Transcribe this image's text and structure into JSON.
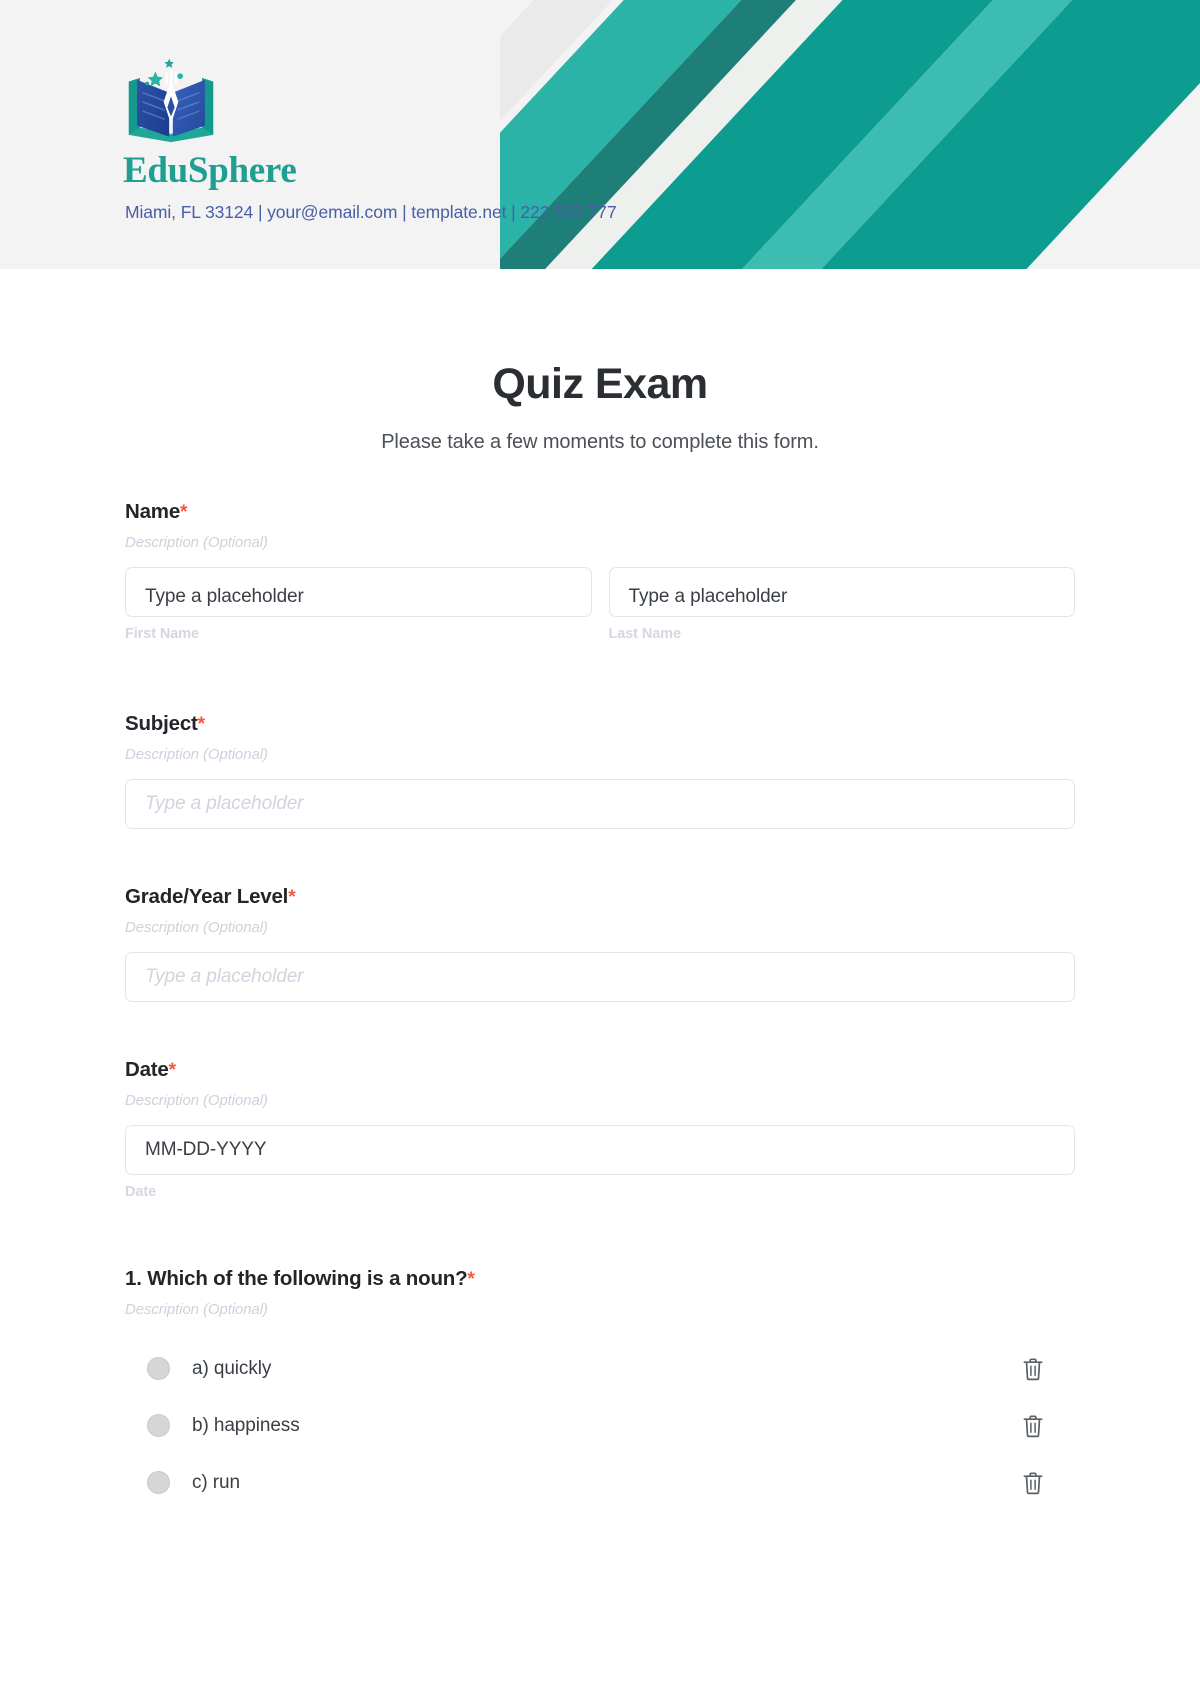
{
  "header": {
    "brand_name": "EduSphere",
    "contact": "Miami, FL 33124 | your@email.com | template.net | 222 555 777",
    "logo_icon": "open-book-pen-logo",
    "background_color": "#f2f3f2",
    "stripe_colors": [
      "#e9eae9",
      "#2bb3a7",
      "#1d7f78",
      "#eef0ee",
      "#17a79b",
      "#3dbdb2",
      "#0f9c90"
    ],
    "brand_color": "#1f9e92",
    "contact_color": "#4a5ea8"
  },
  "form": {
    "title": "Quiz Exam",
    "subtitle": "Please take a few moments to complete this form.",
    "required_marker": "*",
    "description_placeholder": "Description (Optional)",
    "fields": [
      {
        "label": "Name",
        "required": true,
        "description": "Description (Optional)",
        "inputs": [
          {
            "value": "Type a placeholder",
            "sublabel": "First Name"
          },
          {
            "value": "Type a placeholder",
            "sublabel": "Last Name"
          }
        ]
      },
      {
        "label": "Subject",
        "required": true,
        "description": "Description (Optional)",
        "placeholder": "Type a placeholder"
      },
      {
        "label": "Grade/Year Level",
        "required": true,
        "description": "Description (Optional)",
        "placeholder": "Type a placeholder"
      },
      {
        "label": "Date",
        "required": true,
        "description": "Description (Optional)",
        "value": "MM-DD-YYYY",
        "sublabel": "Date"
      }
    ],
    "question": {
      "label": "1. Which of the following is a noun?",
      "required": true,
      "description": "Description (Optional)",
      "options": [
        {
          "text": "a) quickly",
          "delete_icon": "trash-icon"
        },
        {
          "text": "b) happiness",
          "delete_icon": "trash-icon"
        },
        {
          "text": "c) run",
          "delete_icon": "trash-icon"
        }
      ]
    }
  }
}
